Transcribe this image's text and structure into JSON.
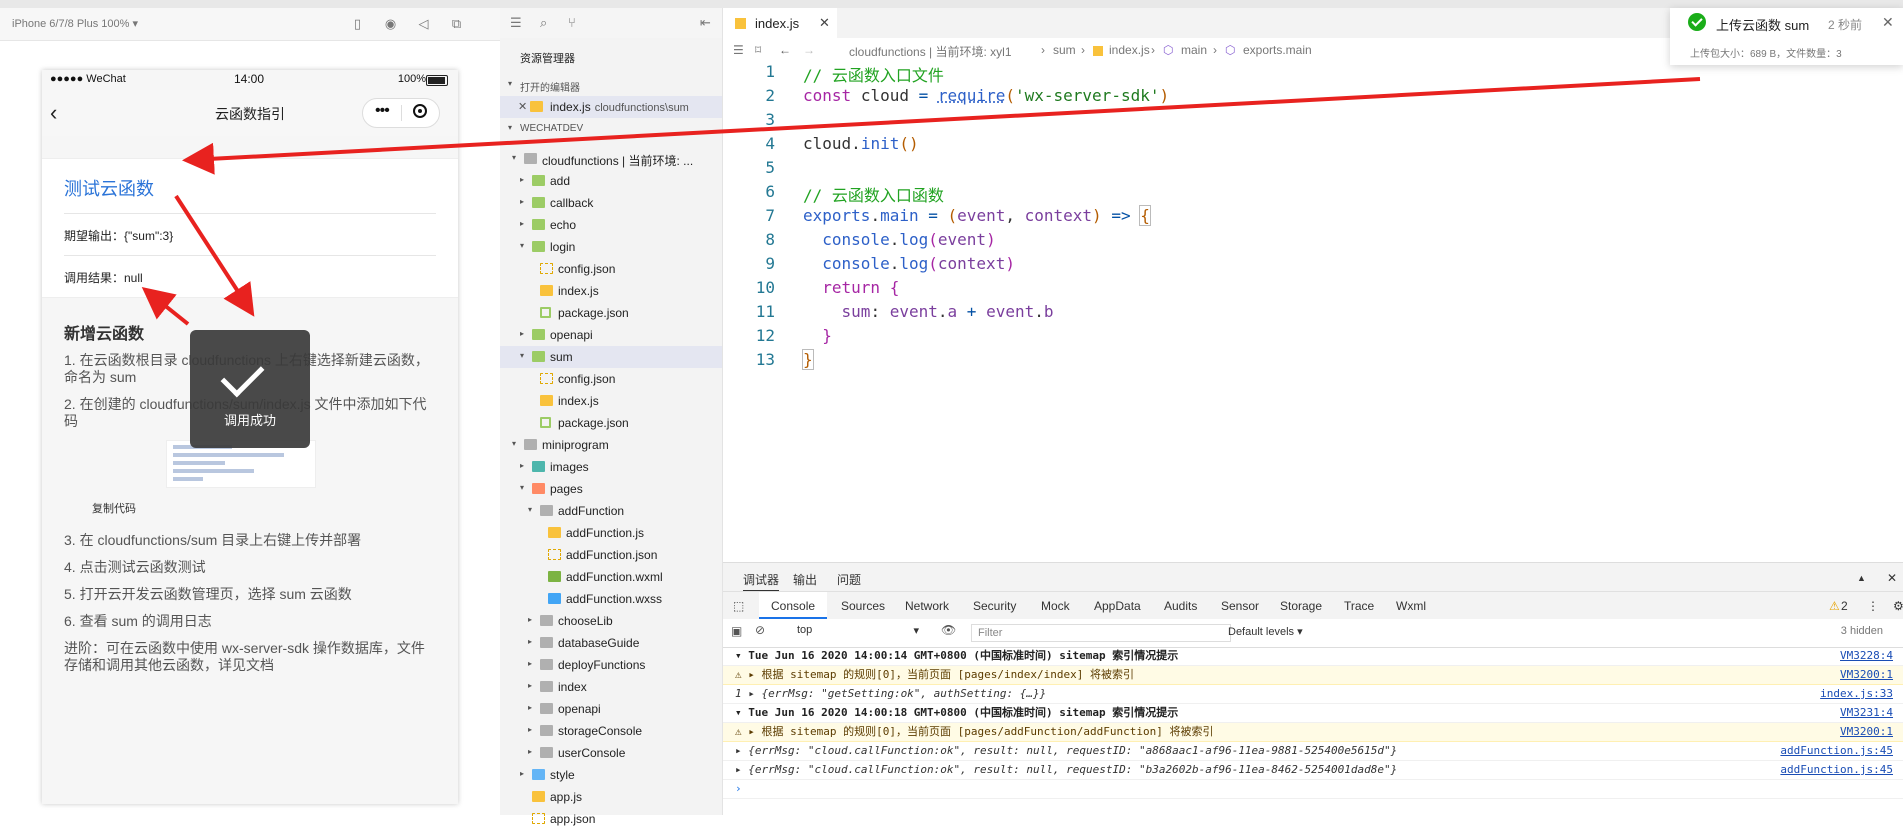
{
  "simulator": {
    "device": "iPhone 6/7/8 Plus 100% ▾",
    "status": {
      "carrier": "●●●●● WeChat",
      "time": "14:00",
      "battery": "100%"
    },
    "nav_title": "云函数指引",
    "card": {
      "title": "测试云函数",
      "expected": "期望输出：{\"sum\":3}",
      "result": "调用结果：null"
    },
    "guide": {
      "title": "新增云函数",
      "step1": "1. 在云函数根目录 cloudfunctions 上右键选择新建云函数，命名为 sum",
      "step2": "2. 在创建的 cloudfunctions/sum/index.js 文件中添加如下代码",
      "copy": "复制代码",
      "step3": "3. 在 cloudfunctions/sum 目录上右键上传并部署",
      "step4": "4. 点击测试云函数测试",
      "step5": "5. 打开云开发云函数管理页，选择 sum 云函数",
      "step6": "6. 查看 sum 的调用日志",
      "advanced": "进阶：可在云函数中使用 wx-server-sdk 操作数据库，文件存储和调用其他云函数，详见文档"
    },
    "toast": "调用成功"
  },
  "explorer": {
    "title": "资源管理器",
    "open_editors": "打开的编辑器",
    "open_file": "index.js",
    "open_file_path": "cloudfunctions\\sum",
    "project": "WECHATDEV",
    "tree": [
      {
        "label": "cloudfunctions | 当前环境: ...",
        "depth": 1,
        "arrow": "▾",
        "icon": "foldg"
      },
      {
        "label": "add",
        "depth": 2,
        "arrow": "▸",
        "icon": "fold"
      },
      {
        "label": "callback",
        "depth": 2,
        "arrow": "▸",
        "icon": "fold"
      },
      {
        "label": "echo",
        "depth": 2,
        "arrow": "▸",
        "icon": "fold"
      },
      {
        "label": "login",
        "depth": 2,
        "arrow": "▾",
        "icon": "fold"
      },
      {
        "label": "config.json",
        "depth": 3,
        "arrow": "",
        "icon": "fjson"
      },
      {
        "label": "index.js",
        "depth": 3,
        "arrow": "",
        "icon": "fjs"
      },
      {
        "label": "package.json",
        "depth": 3,
        "arrow": "",
        "icon": "fpkg"
      },
      {
        "label": "openapi",
        "depth": 2,
        "arrow": "▸",
        "icon": "fold"
      },
      {
        "label": "sum",
        "depth": 2,
        "arrow": "▾",
        "icon": "fold",
        "selected": true
      },
      {
        "label": "config.json",
        "depth": 3,
        "arrow": "",
        "icon": "fjson"
      },
      {
        "label": "index.js",
        "depth": 3,
        "arrow": "",
        "icon": "fjs"
      },
      {
        "label": "package.json",
        "depth": 3,
        "arrow": "",
        "icon": "fpkg"
      },
      {
        "label": "miniprogram",
        "depth": 1,
        "arrow": "▾",
        "icon": "foldg"
      },
      {
        "label": "images",
        "depth": 2,
        "arrow": "▸",
        "icon": "foldt"
      },
      {
        "label": "pages",
        "depth": 2,
        "arrow": "▾",
        "icon": "foldo"
      },
      {
        "label": "addFunction",
        "depth": 3,
        "arrow": "▾",
        "icon": "foldg"
      },
      {
        "label": "addFunction.js",
        "depth": 4,
        "arrow": "",
        "icon": "fjs"
      },
      {
        "label": "addFunction.json",
        "depth": 4,
        "arrow": "",
        "icon": "fjson"
      },
      {
        "label": "addFunction.wxml",
        "depth": 4,
        "arrow": "",
        "icon": "fwx"
      },
      {
        "label": "addFunction.wxss",
        "depth": 4,
        "arrow": "",
        "icon": "fwxss"
      },
      {
        "label": "chooseLib",
        "depth": 3,
        "arrow": "▸",
        "icon": "foldg"
      },
      {
        "label": "databaseGuide",
        "depth": 3,
        "arrow": "▸",
        "icon": "foldg"
      },
      {
        "label": "deployFunctions",
        "depth": 3,
        "arrow": "▸",
        "icon": "foldg"
      },
      {
        "label": "index",
        "depth": 3,
        "arrow": "▸",
        "icon": "foldg"
      },
      {
        "label": "openapi",
        "depth": 3,
        "arrow": "▸",
        "icon": "foldg"
      },
      {
        "label": "storageConsole",
        "depth": 3,
        "arrow": "▸",
        "icon": "foldg"
      },
      {
        "label": "userConsole",
        "depth": 3,
        "arrow": "▸",
        "icon": "foldg"
      },
      {
        "label": "style",
        "depth": 2,
        "arrow": "▸",
        "icon": "foldb"
      },
      {
        "label": "app.js",
        "depth": 2,
        "arrow": "",
        "icon": "fjs"
      },
      {
        "label": "app.json",
        "depth": 2,
        "arrow": "",
        "icon": "fjson"
      }
    ]
  },
  "editor": {
    "tab": "index.js",
    "breadcrumb": {
      "root": "cloudfunctions | 当前环境: xyl1",
      "sum": "sum",
      "file": "index.js",
      "main": "main",
      "exports": "exports.main"
    },
    "code": {
      "l1": "// 云函数入口文件",
      "l2a": "const",
      "l2b": "cloud",
      "l2c": "require",
      "l2d": "'wx-server-sdk'",
      "l4a": "cloud",
      "l4b": "init",
      "l6": "// 云函数入口函数",
      "l7a": "exports",
      "l7b": "main",
      "l7c": "event",
      "l7d": "context",
      "l8a": "console",
      "l8b": "log",
      "l8c": "event",
      "l9a": "console",
      "l9b": "log",
      "l9c": "context",
      "l10": "return",
      "l11a": "sum",
      "l11b": "event",
      "l11c": "a",
      "l11d": "event",
      "l11e": "b"
    },
    "lines": [
      "1",
      "2",
      "3",
      "4",
      "5",
      "6",
      "7",
      "8",
      "9",
      "10",
      "11",
      "12",
      "13"
    ]
  },
  "notification": {
    "title": "上传云函数 sum",
    "time": "2 秒前",
    "detail": "上传包大小：689 B，文件数量：3"
  },
  "debugger": {
    "tabs": [
      "调试器",
      "输出",
      "问题"
    ],
    "panels": [
      "Console",
      "Sources",
      "Network",
      "Security",
      "Mock",
      "AppData",
      "Audits",
      "Sensor",
      "Storage",
      "Trace",
      "Wxml"
    ],
    "context": "top",
    "filter_placeholder": "Filter",
    "levels": "Default levels ▾",
    "hidden": "3 hidden",
    "warn_count": "2",
    "logs": [
      {
        "kind": "hd",
        "text": "▾ Tue Jun 16 2020 14:00:14 GMT+0800 (中国标准时间) sitemap 索引情况提示",
        "src": "VM3228:4"
      },
      {
        "kind": "warn",
        "text": "⚠ ▸ 根据 sitemap 的规则[0]，当前页面 [pages/index/index] 将被索引",
        "src": "VM3200:1"
      },
      {
        "kind": "obj",
        "text": "1 ▸ {errMsg: \"getSetting:ok\", authSetting: {…}}",
        "src": "index.js:33"
      },
      {
        "kind": "hd",
        "text": "▾ Tue Jun 16 2020 14:00:18 GMT+0800 (中国标准时间) sitemap 索引情况提示",
        "src": "VM3231:4"
      },
      {
        "kind": "warn",
        "text": "⚠ ▸ 根据 sitemap 的规则[0]，当前页面 [pages/addFunction/addFunction] 将被索引",
        "src": "VM3200:1"
      },
      {
        "kind": "obj",
        "text": "▸ {errMsg: \"cloud.callFunction:ok\", result: null, requestID: \"a868aac1-af96-11ea-9881-525400e5615d\"}",
        "src": "addFunction.js:45"
      },
      {
        "kind": "obj",
        "text": "▸ {errMsg: \"cloud.callFunction:ok\", result: null, requestID: \"b3a2602b-af96-11ea-8462-5254001dad8e\"}",
        "src": "addFunction.js:45"
      }
    ],
    "prompt": "›"
  },
  "annotation": {
    "arrow_color": "#e8221f"
  }
}
